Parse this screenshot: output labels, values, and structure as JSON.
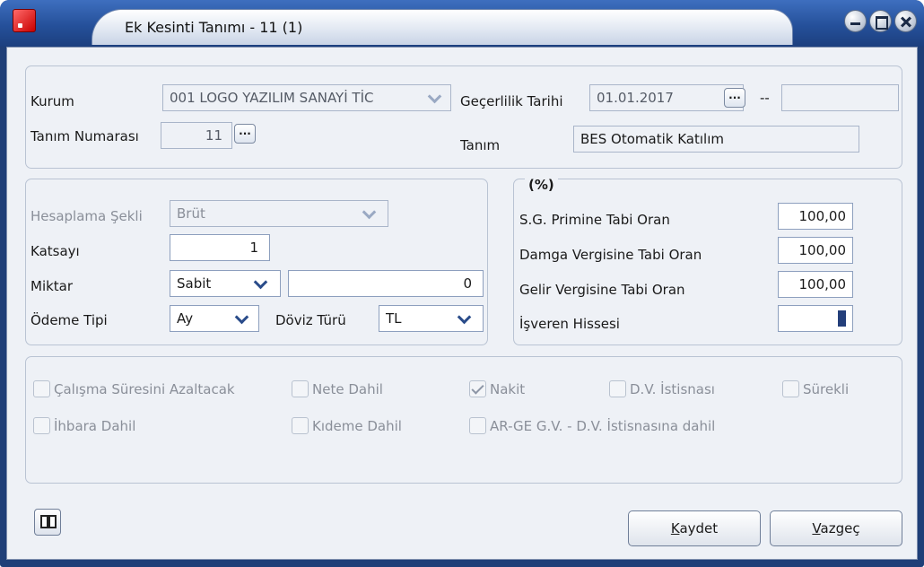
{
  "window": {
    "title": "Ek Kesinti Tanımı - 11 (1)"
  },
  "header": {
    "kurum_label": "Kurum",
    "kurum_value": "001 LOGO YAZILIM SANAYİ TİC",
    "gecerlilik_label": "Geçerlilik Tarihi",
    "gecerlilik_value": "01.01.2017",
    "gecerlilik_sep": "--",
    "gecerlilik_end": "",
    "tanim_no_label": "Tanım Numarası",
    "tanim_no_value": "11",
    "tanim_label": "Tanım",
    "tanim_value": "BES Otomatik Katılım"
  },
  "calc": {
    "hesaplama_label": "Hesaplama Şekli",
    "hesaplama_value": "Brüt",
    "katsayi_label": "Katsayı",
    "katsayi_value": "1",
    "miktar_label": "Miktar",
    "miktar_type": "Sabit",
    "miktar_value": "0",
    "odeme_label": "Ödeme Tipi",
    "odeme_value": "Ay",
    "doviz_label": "Döviz Türü",
    "doviz_value": "TL"
  },
  "rates": {
    "title": "(%)",
    "sg_label": "S.G. Primine Tabi Oran",
    "sg_value": "100,00",
    "damga_label": "Damga Vergisine Tabi Oran",
    "damga_value": "100,00",
    "gelir_label": "Gelir Vergisine Tabi Oran",
    "gelir_value": "100,00",
    "isveren_label": "İşveren Hissesi",
    "isveren_value": ""
  },
  "options": {
    "calisma": "Çalışma Süresini Azaltacak",
    "nete": "Nete Dahil",
    "nakit": "Nakit",
    "dv_istisnasi": "D.V. İstisnası",
    "surekli": "Sürekli",
    "ihbara": "İhbara Dahil",
    "kideme": "Kıdeme Dahil",
    "arge": "AR-GE G.V. - D.V. İstisnasına dahil"
  },
  "buttons": {
    "save_mnemonic": "K",
    "save_rest": "aydet",
    "cancel_mnemonic": "V",
    "cancel_rest": "azgeç"
  }
}
